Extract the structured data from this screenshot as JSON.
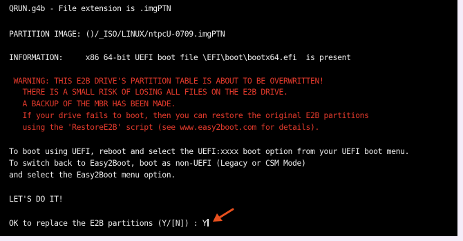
{
  "terminal": {
    "header": "QRUN.g4b - File extension is .imgPTN",
    "partition_image": "PARTITION IMAGE: ()/_ISO/LINUX/ntpcU-0709.imgPTN",
    "information": "INFORMATION:     x86 64-bit UEFI boot file \\EFI\\boot\\bootx64.efi  is present",
    "warning_lines": [
      " WARNING: THIS E2B DRIVE'S PARTITION TABLE IS ABOUT TO BE OVERWRITTEN!",
      "   THERE IS A SMALL RISK OF LOSING ALL FILES ON THE E2B DRIVE.",
      "   A BACKUP OF THE MBR HAS BEEN MADE.",
      "   If your drive fails to boot, then you can restore the original E2B partitions",
      "   using the 'RestoreE2B' script (see www.easy2boot.com for details)."
    ],
    "uefi_lines": [
      "To boot using UEFI, reboot and select the UEFI:xxxx boot option from your UEFI boot menu.",
      "To switch back to Easy2Boot, boot as non-UEFI (Legacy or CSM Mode)",
      "and select the Easy2Boot menu option."
    ],
    "lets_do_it": "LET'S DO IT!",
    "prompt": "OK to replace the E2B partitions (Y/[N]) : ",
    "input_value": "Y"
  },
  "colors": {
    "background": "#000000",
    "text": "#ececec",
    "warning": "#e33a2c",
    "arrow": "#e8501e",
    "frame": "#f4edf9"
  },
  "icons": {
    "pointer": "arrow-icon"
  }
}
